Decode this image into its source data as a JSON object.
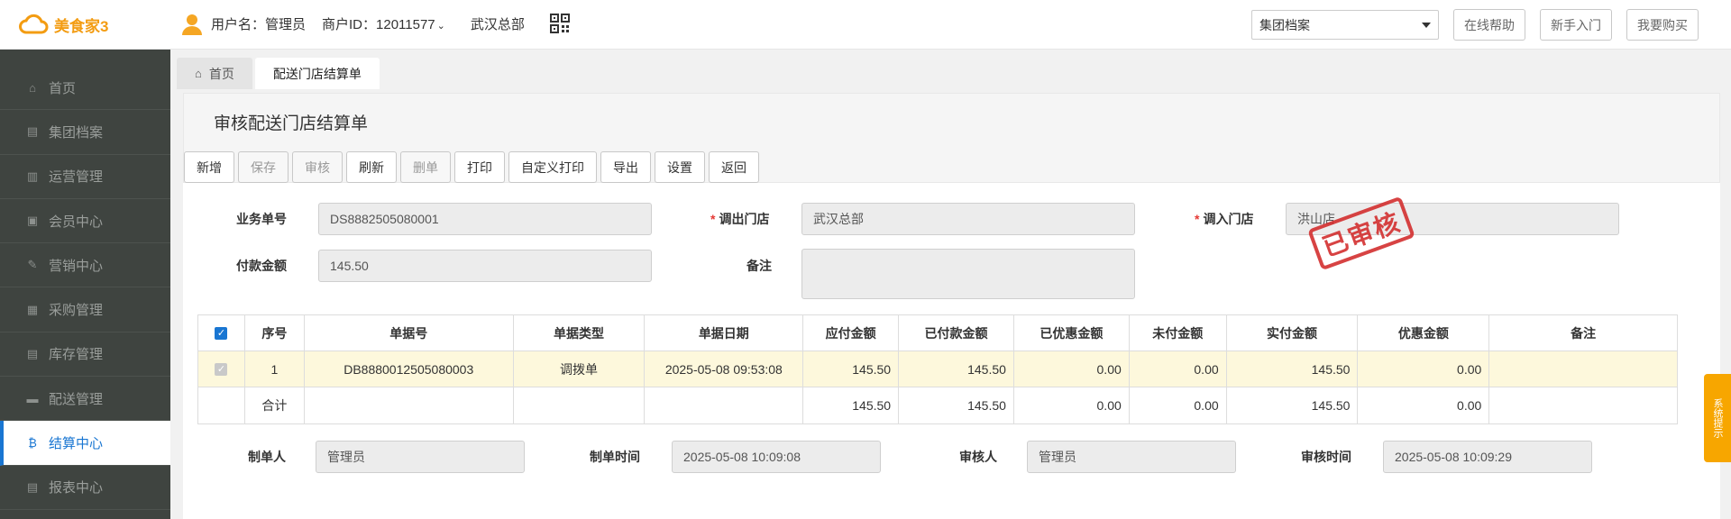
{
  "app": {
    "logo_text": "美食家3"
  },
  "header": {
    "username": "用户名：管理员",
    "merchant": "商户ID：12011577",
    "store": "武汉总部",
    "org_select": "集团档案",
    "help": "在线帮助",
    "guide": "新手入门",
    "buy": "我要购买"
  },
  "sidebar": {
    "items": [
      {
        "label": "首页",
        "icon": "home-icon"
      },
      {
        "label": "集团档案",
        "icon": "file-icon"
      },
      {
        "label": "运营管理",
        "icon": "chart-icon"
      },
      {
        "label": "会员中心",
        "icon": "id-card-icon"
      },
      {
        "label": "营销中心",
        "icon": "edit-icon"
      },
      {
        "label": "采购管理",
        "icon": "book-icon"
      },
      {
        "label": "库存管理",
        "icon": "file-icon"
      },
      {
        "label": "配送管理",
        "icon": "truck-icon"
      },
      {
        "label": "结算中心",
        "icon": "bitcoin-icon"
      },
      {
        "label": "报表中心",
        "icon": "file-icon"
      }
    ],
    "active_index": 8
  },
  "tabs": [
    {
      "label": "首页"
    },
    {
      "label": "配送门店结算单"
    }
  ],
  "page": {
    "title": "审核配送门店结算单",
    "toolbar": [
      {
        "label": "新增",
        "enabled": true
      },
      {
        "label": "保存",
        "enabled": false
      },
      {
        "label": "审核",
        "enabled": false
      },
      {
        "label": "刷新",
        "enabled": true
      },
      {
        "label": "删单",
        "enabled": false
      },
      {
        "label": "打印",
        "enabled": true
      },
      {
        "label": "自定义打印",
        "enabled": true
      },
      {
        "label": "导出",
        "enabled": true
      },
      {
        "label": "设置",
        "enabled": true
      },
      {
        "label": "返回",
        "enabled": true
      }
    ]
  },
  "form": {
    "doc_no_label": "业务单号",
    "doc_no": "DS8882505080001",
    "out_store_label": "调出门店",
    "out_store": "武汉总部",
    "in_store_label": "调入门店",
    "in_store": "洪山店",
    "pay_amount_label": "付款金额",
    "pay_amount": "145.50",
    "remark_label": "备注",
    "remark": "",
    "stamp": "已审核"
  },
  "table": {
    "headers": [
      "序号",
      "单据号",
      "单据类型",
      "单据日期",
      "应付金额",
      "已付款金额",
      "已优惠金额",
      "未付金额",
      "实付金额",
      "优惠金额",
      "备注"
    ],
    "rows": [
      {
        "seq": "1",
        "doc": "DB8880012505080003",
        "type": "调拨单",
        "date": "2025-05-08 09:53:08",
        "payable": "145.50",
        "paid": "145.50",
        "discounted": "0.00",
        "unpaid": "0.00",
        "actual": "145.50",
        "discount": "0.00",
        "remark": ""
      }
    ],
    "total": {
      "label": "合计",
      "payable": "145.50",
      "paid": "145.50",
      "discounted": "0.00",
      "unpaid": "0.00",
      "actual": "145.50",
      "discount": "0.00"
    }
  },
  "footer": {
    "maker_label": "制单人",
    "maker": "管理员",
    "make_time_label": "制单时间",
    "make_time": "2025-05-08 10:09:08",
    "auditor_label": "审核人",
    "auditor": "管理员",
    "audit_time_label": "审核时间",
    "audit_time": "2025-05-08 10:09:29"
  },
  "side_tab": {
    "label": "系统提示"
  },
  "colors": {
    "accent": "#1976d2",
    "logo": "#f39c12",
    "stamp": "#d32f2f",
    "sidebar": "#3f4440"
  }
}
